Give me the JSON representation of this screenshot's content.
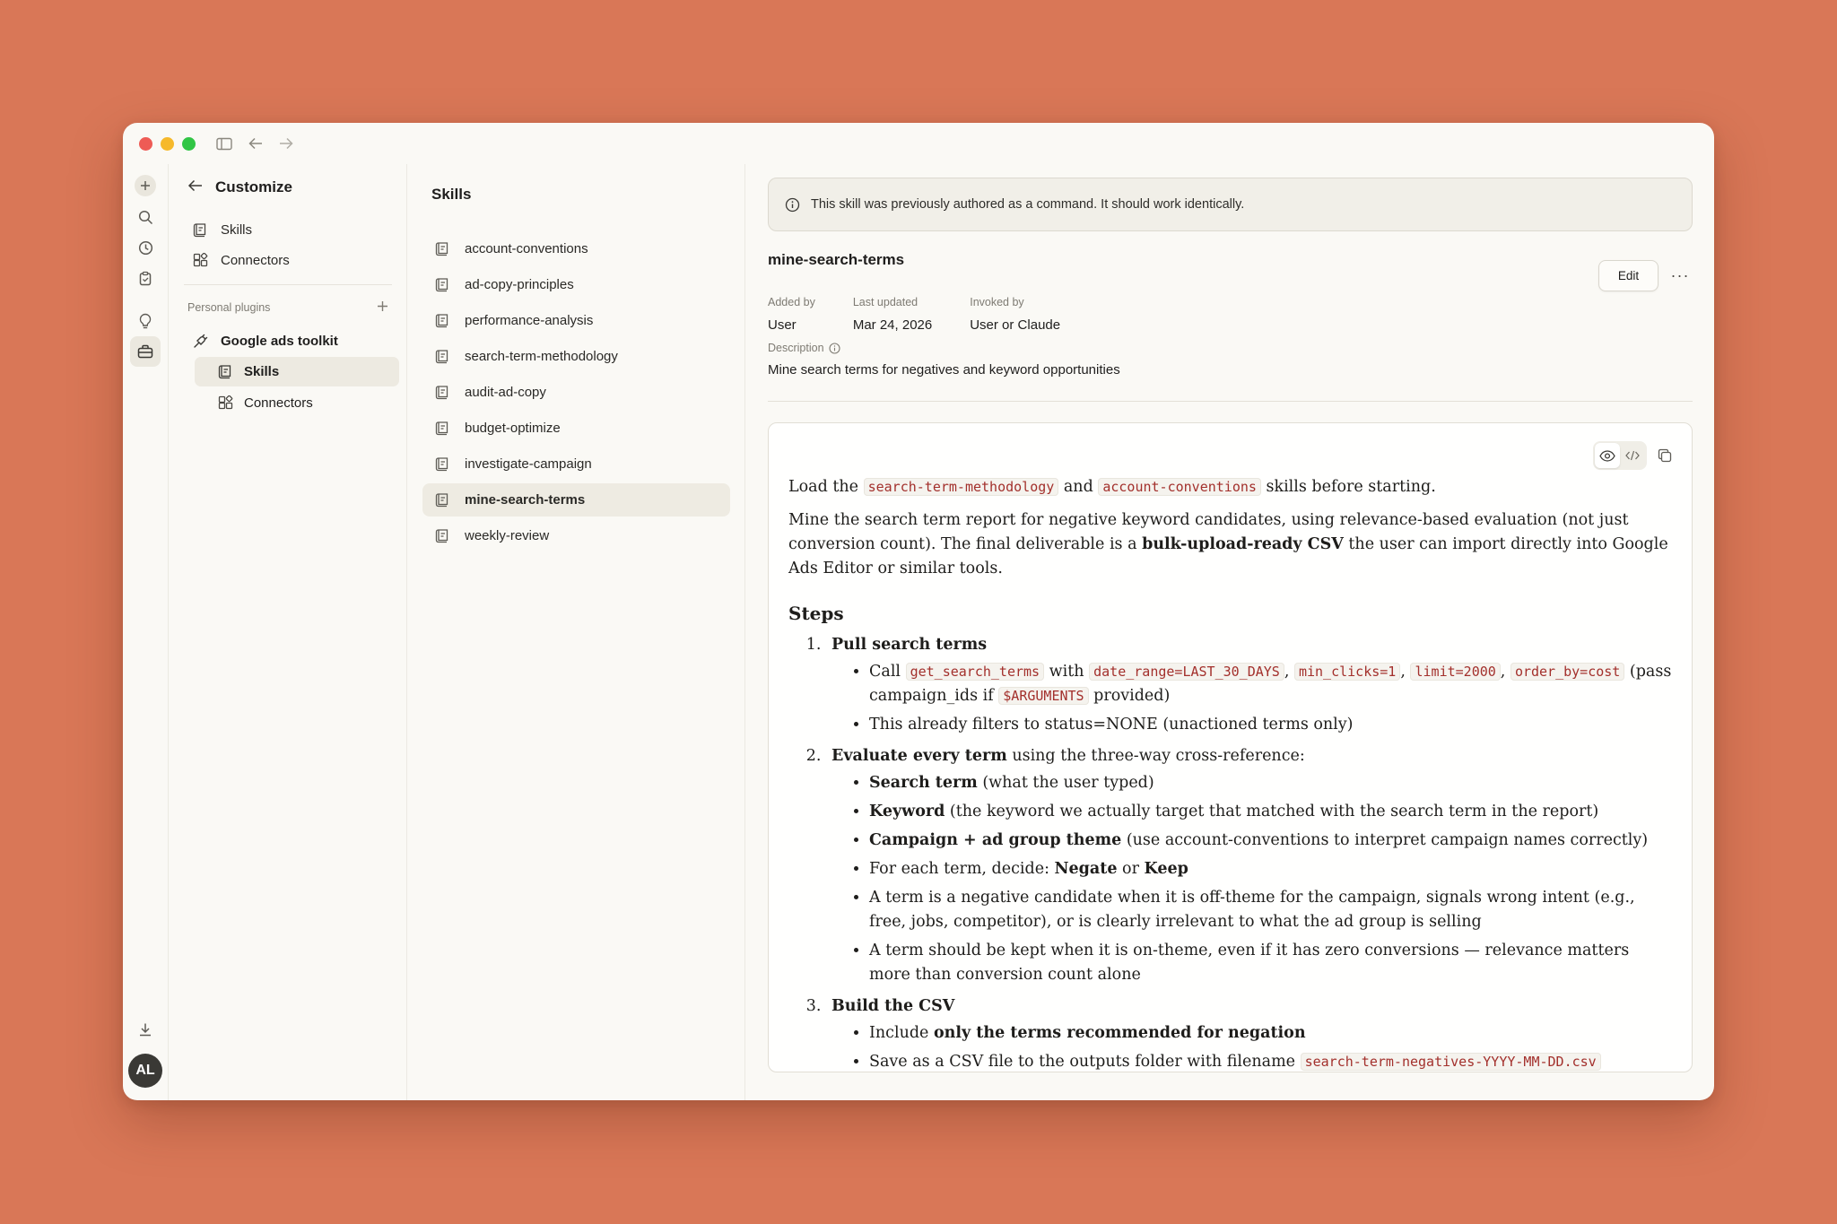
{
  "colors": {
    "background": "#d97757",
    "window": "#faf9f5",
    "code_text": "#a3302c"
  },
  "rail": {
    "avatar_initials": "AL"
  },
  "nav": {
    "title": "Customize",
    "items": [
      {
        "label": "Skills",
        "icon": "skills-icon"
      },
      {
        "label": "Connectors",
        "icon": "connectors-icon"
      }
    ],
    "section_label": "Personal plugins",
    "plugin_name": "Google ads toolkit",
    "plugin_items": [
      {
        "label": "Skills"
      },
      {
        "label": "Connectors"
      }
    ]
  },
  "skills": {
    "title": "Skills",
    "items": [
      "account-conventions",
      "ad-copy-principles",
      "performance-analysis",
      "search-term-methodology",
      "audit-ad-copy",
      "budget-optimize",
      "investigate-campaign",
      "mine-search-terms",
      "weekly-review"
    ],
    "selected": "mine-search-terms"
  },
  "detail": {
    "notice": "This skill was previously authored as a command. It should work identically.",
    "name": "mine-search-terms",
    "edit_label": "Edit",
    "more_label": "···",
    "meta": [
      {
        "label": "Added by",
        "value": "User"
      },
      {
        "label": "Last updated",
        "value": "Mar 24, 2026"
      },
      {
        "label": "Invoked by",
        "value": "User or Claude"
      }
    ],
    "description_label": "Description",
    "description": "Mine search terms for negatives and keyword opportunities"
  },
  "doc": {
    "p1": {
      "t1": "Load the ",
      "c1": "search-term-methodology",
      "t2": " and ",
      "c2": "account-conventions",
      "t3": " skills before starting."
    },
    "p2": {
      "t1": "Mine the search term report for negative keyword candidates, using relevance-based evaluation (not just conversion count). The final deliverable is a ",
      "b1": "bulk-upload-ready CSV",
      "t2": " the user can import directly into Google Ads Editor or similar tools."
    },
    "steps_heading": "Steps",
    "step1": {
      "title": "Pull search terms",
      "b1": {
        "t1": "Call ",
        "c1": "get_search_terms",
        "t2": " with ",
        "c2": "date_range=LAST_30_DAYS",
        "s1": ", ",
        "c3": "min_clicks=1",
        "s2": ", ",
        "c4": "limit=2000",
        "s3": ", ",
        "c5": "order_by=cost",
        "t3": " (pass campaign_ids if ",
        "c6": "$ARGUMENTS",
        "t4": " provided)"
      },
      "b2": "This already filters to status=NONE (unactioned terms only)"
    },
    "step2": {
      "title": "Evaluate every term",
      "title_rest": " using the three-way cross-reference:",
      "b1": {
        "b": "Search term",
        "t": " (what the user typed)"
      },
      "b2": {
        "b": "Keyword",
        "t": " (the keyword we actually target that matched with the search term in the report)"
      },
      "b3": {
        "b": "Campaign + ad group theme",
        "t": " (use account-conventions to interpret campaign names correctly)"
      },
      "b4": {
        "t1": "For each term, decide: ",
        "b1": "Negate",
        "t2": " or ",
        "b2": "Keep"
      },
      "b5": "A term is a negative candidate when it is off-theme for the campaign, signals wrong intent (e.g., free, jobs, competitor), or is clearly irrelevant to what the ad group is selling",
      "b6": "A term should be kept when it is on-theme, even if it has zero conversions — relevance matters more than conversion count alone"
    },
    "step3": {
      "title": "Build the CSV",
      "b1": {
        "t": "Include ",
        "b": "only the terms recommended for negation"
      },
      "b2": {
        "t": "Save as a CSV file to the outputs folder with filename ",
        "c": "search-term-negatives-YYYY-MM-DD.csv"
      }
    }
  }
}
